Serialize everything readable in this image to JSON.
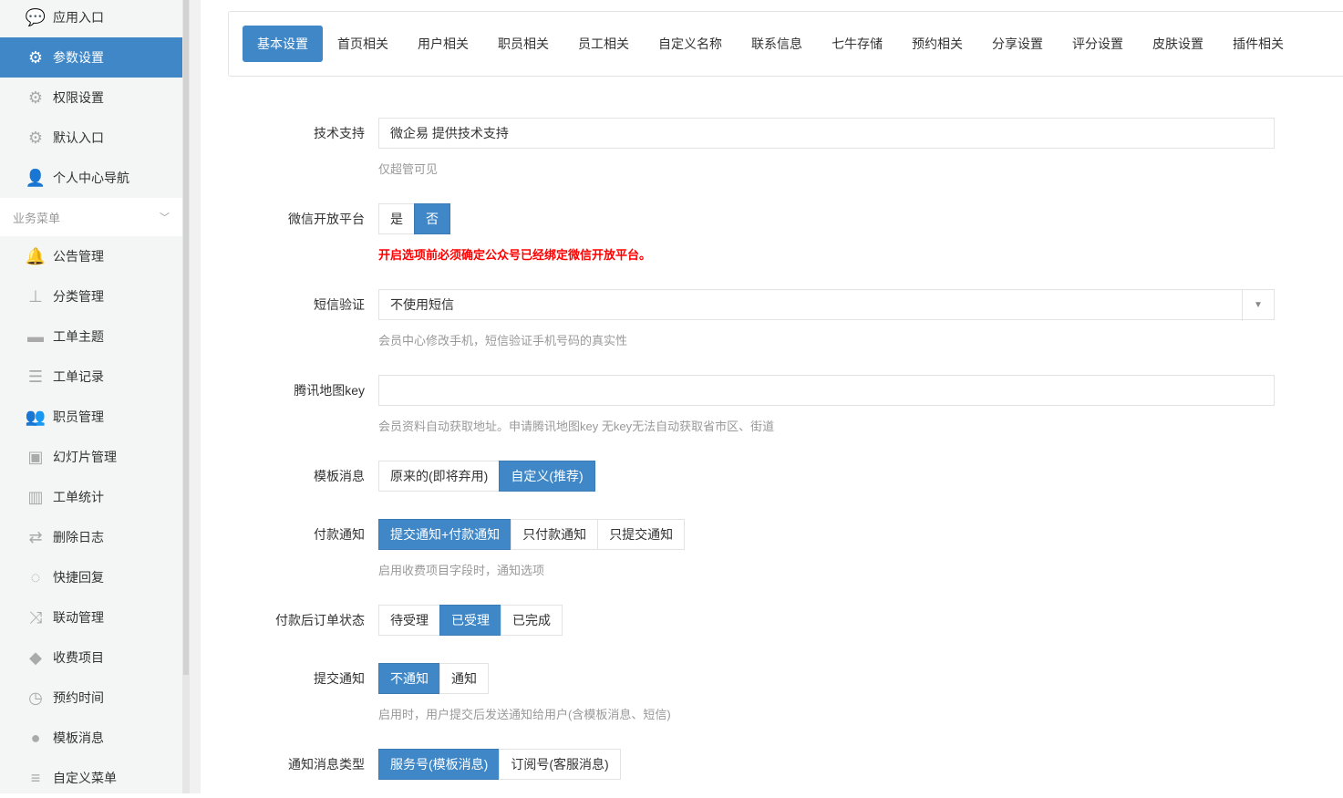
{
  "sidebar": {
    "top_items": [
      {
        "label": "应用入口",
        "icon": "chat-icon"
      },
      {
        "label": "参数设置",
        "icon": "gear-icon",
        "active": true
      },
      {
        "label": "权限设置",
        "icon": "gear-icon"
      },
      {
        "label": "默认入口",
        "icon": "gear-icon"
      },
      {
        "label": "个人中心导航",
        "icon": "user-icon"
      }
    ],
    "group_label": "业务菜单",
    "items": [
      {
        "label": "公告管理",
        "icon": "bell-icon"
      },
      {
        "label": "分类管理",
        "icon": "sitemap-icon"
      },
      {
        "label": "工单主题",
        "icon": "briefcase-icon"
      },
      {
        "label": "工单记录",
        "icon": "list-icon"
      },
      {
        "label": "职员管理",
        "icon": "users-icon"
      },
      {
        "label": "幻灯片管理",
        "icon": "image-icon"
      },
      {
        "label": "工单统计",
        "icon": "bar-chart-icon"
      },
      {
        "label": "删除日志",
        "icon": "retweet-icon"
      },
      {
        "label": "快捷回复",
        "icon": "comments-icon"
      },
      {
        "label": "联动管理",
        "icon": "random-icon"
      },
      {
        "label": "收费项目",
        "icon": "tags-icon"
      },
      {
        "label": "预约时间",
        "icon": "clock-icon"
      },
      {
        "label": "模板消息",
        "icon": "wechat-icon"
      },
      {
        "label": "自定义菜单",
        "icon": "menu-icon"
      }
    ]
  },
  "tabs": [
    "基本设置",
    "首页相关",
    "用户相关",
    "职员相关",
    "员工相关",
    "自定义名称",
    "联系信息",
    "七牛存储",
    "预约相关",
    "分享设置",
    "评分设置",
    "皮肤设置",
    "插件相关"
  ],
  "form": {
    "tech": {
      "label": "技术支持",
      "value": "微企易 提供技术支持",
      "help": "仅超管可见"
    },
    "open": {
      "label": "微信开放平台",
      "options": [
        "是",
        "否"
      ],
      "selected": 1,
      "warn": "开启选项前必须确定公众号已经绑定微信开放平台。"
    },
    "sms": {
      "label": "短信验证",
      "value": "不使用短信",
      "help": "会员中心修改手机，短信验证手机号码的真实性"
    },
    "map": {
      "label": "腾讯地图key",
      "value": "",
      "help": "会员资料自动获取地址。申请腾讯地图key 无key无法自动获取省市区、街道"
    },
    "tpl": {
      "label": "模板消息",
      "options": [
        "原来的(即将弃用)",
        "自定义(推荐)"
      ],
      "selected": 1
    },
    "pay": {
      "label": "付款通知",
      "options": [
        "提交通知+付款通知",
        "只付款通知",
        "只提交通知"
      ],
      "selected": 0,
      "help": "启用收费项目字段时，通知选项"
    },
    "status": {
      "label": "付款后订单状态",
      "options": [
        "待受理",
        "已受理",
        "已完成"
      ],
      "selected": 1
    },
    "submit": {
      "label": "提交通知",
      "options": [
        "不通知",
        "通知"
      ],
      "selected": 0,
      "help": "启用时，用户提交后发送通知给用户(含模板消息、短信)"
    },
    "msgtype": {
      "label": "通知消息类型",
      "options": [
        "服务号(模板消息)",
        "订阅号(客服消息)"
      ],
      "selected": 0
    }
  },
  "colors": {
    "accent": "#3f87c6",
    "warn": "#ff0000"
  }
}
